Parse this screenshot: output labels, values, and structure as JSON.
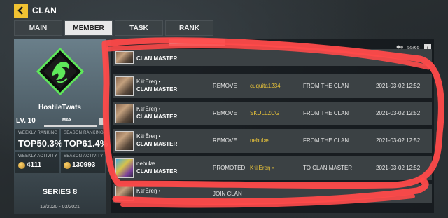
{
  "header": {
    "title": "CLAN",
    "back_icon": "chevron-left-icon",
    "accent": "#f1c232"
  },
  "tabs": [
    {
      "label": "MAIN",
      "active": false
    },
    {
      "label": "MEMBER",
      "active": true
    },
    {
      "label": "TASK",
      "active": false
    },
    {
      "label": "RANK",
      "active": false
    }
  ],
  "clan": {
    "name": "HostileTwats",
    "level": "LV. 10",
    "max_label": "MAX",
    "weekly_ranking_label": "WEEKLY RANKING",
    "weekly_ranking": "TOP50.3%",
    "season_ranking_label": "SEASON RANKING",
    "season_ranking": "TOP61.4%",
    "weekly_activity_label": "WEEKLY ACTIVITY",
    "weekly_activity": "4111",
    "season_activity_label": "SEASON ACTIVITY",
    "season_activity": "130993",
    "series": "SERIES 8",
    "series_dates": "12/2020 - 03/2021"
  },
  "members_panel": {
    "count": "55/65",
    "members_icon": "members-icon",
    "info_icon": "info-icon",
    "info_glyph": "i",
    "rows": [
      {
        "name1": "",
        "name2": "CLAN MASTER",
        "action": "",
        "target": "",
        "from": "",
        "date": ""
      },
      {
        "name1": "K♕Ēreŋ •",
        "name2": "CLAN MASTER",
        "action": "REMOVE",
        "target": "cuquita1234",
        "from": "FROM THE CLAN",
        "date": "2021-03-02 12:52"
      },
      {
        "name1": "K♕Ēreŋ •",
        "name2": "CLAN MASTER",
        "action": "REMOVE",
        "target": "SKULLZCG",
        "from": "FROM THE CLAN",
        "date": "2021-03-02 12:52"
      },
      {
        "name1": "K♕Ēreŋ •",
        "name2": "CLAN MASTER",
        "action": "REMOVE",
        "target": "nebulæ",
        "from": "FROM THE CLAN",
        "date": "2021-03-02 12:52"
      },
      {
        "name1": "nebulæ",
        "name2": "CLAN MASTER",
        "action": "PROMOTED",
        "target": "K♕Ēreŋ •",
        "from": "TO CLAN MASTER",
        "date": "2021-03-02 12:52"
      },
      {
        "name1": "K♕Ēreŋ •",
        "name2": "",
        "action": "JOIN CLAN",
        "target": "",
        "from": "",
        "date": ""
      }
    ]
  },
  "annotation_color": "#ff4a4a"
}
